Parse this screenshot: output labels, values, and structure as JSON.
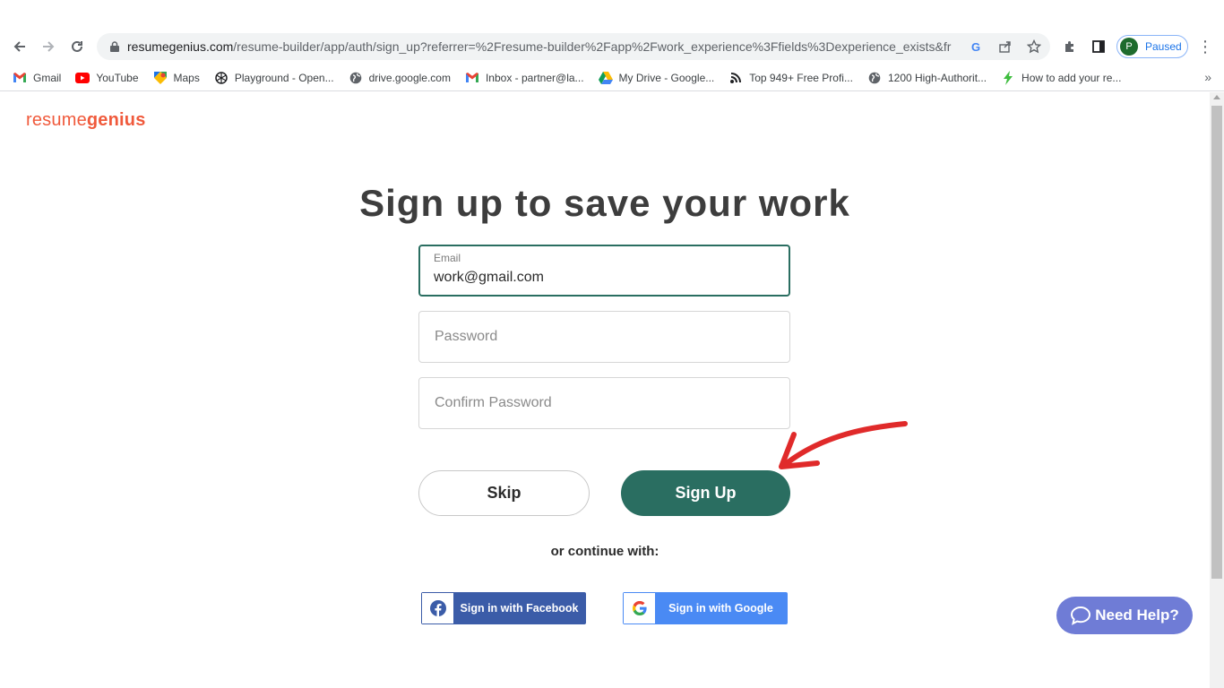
{
  "browser": {
    "url_domain": "resumegenius.com",
    "url_path": "/resume-builder/app/auth/sign_up?referrer=%2Fresume-builder%2Fapp%2Fwork_experience%3Ffields%3Dexperience_exists&fro...",
    "profile_initial": "P",
    "profile_status": "Paused"
  },
  "bookmarks": [
    {
      "label": "Gmail",
      "icon": "gmail-icon"
    },
    {
      "label": "YouTube",
      "icon": "youtube-icon"
    },
    {
      "label": "Maps",
      "icon": "maps-icon"
    },
    {
      "label": "Playground - Open...",
      "icon": "openai-icon"
    },
    {
      "label": "drive.google.com",
      "icon": "globe-icon"
    },
    {
      "label": "Inbox - partner@la...",
      "icon": "gmail-icon"
    },
    {
      "label": "My Drive - Google...",
      "icon": "google-drive-icon"
    },
    {
      "label": "Top 949+ Free Profi...",
      "icon": "feed-icon"
    },
    {
      "label": "1200 High-Authorit...",
      "icon": "globe-icon"
    },
    {
      "label": "How to add your re...",
      "icon": "bolt-icon"
    }
  ],
  "page": {
    "logo_light": "resume",
    "logo_bold": "genius",
    "title": "Sign up to save your work",
    "email_label": "Email",
    "email_value": "work@gmail.com",
    "password_placeholder": "Password",
    "confirm_placeholder": "Confirm Password",
    "skip_label": "Skip",
    "signup_label": "Sign Up",
    "or_text": "or continue with:",
    "facebook_label": "Sign in with Facebook",
    "google_label": "Sign in with Google",
    "help_label": "Need Help?"
  },
  "colors": {
    "brand_orange": "#f05a3c",
    "primary_green": "#2a6e61",
    "facebook_blue": "#3b5ca8",
    "google_blue": "#4a8af4",
    "help_purple": "#6f7cd6",
    "annotation_red": "#e02a2a"
  }
}
